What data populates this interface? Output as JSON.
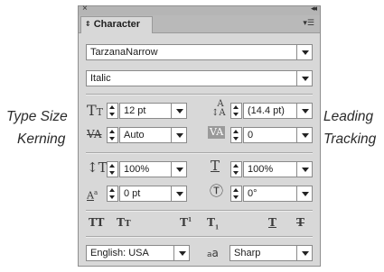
{
  "callouts": {
    "type_size": "Type Size",
    "kerning": "Kerning",
    "leading": "Leading",
    "tracking": "Tracking"
  },
  "panel": {
    "tab_label": "Character",
    "font_family": "TarzanaNarrow",
    "font_style": "Italic",
    "font_size": "12 pt",
    "leading": "(14.4 pt)",
    "kerning": "Auto",
    "tracking": "0",
    "vertical_scale": "100%",
    "horizontal_scale": "100%",
    "baseline_shift": "0 pt",
    "character_rotation": "0°",
    "language": "English: USA",
    "antialiasing": "Sharp"
  },
  "icons": [
    "close-icon",
    "collapse-icon",
    "panel-menu-icon",
    "font-size-icon",
    "leading-icon",
    "kerning-icon",
    "tracking-icon",
    "vertical-scale-icon",
    "horizontal-scale-icon",
    "baseline-shift-icon",
    "rotation-icon",
    "all-caps-icon",
    "small-caps-icon",
    "superscript-icon",
    "subscript-icon",
    "underline-icon",
    "strikethrough-icon",
    "antialias-icon"
  ]
}
